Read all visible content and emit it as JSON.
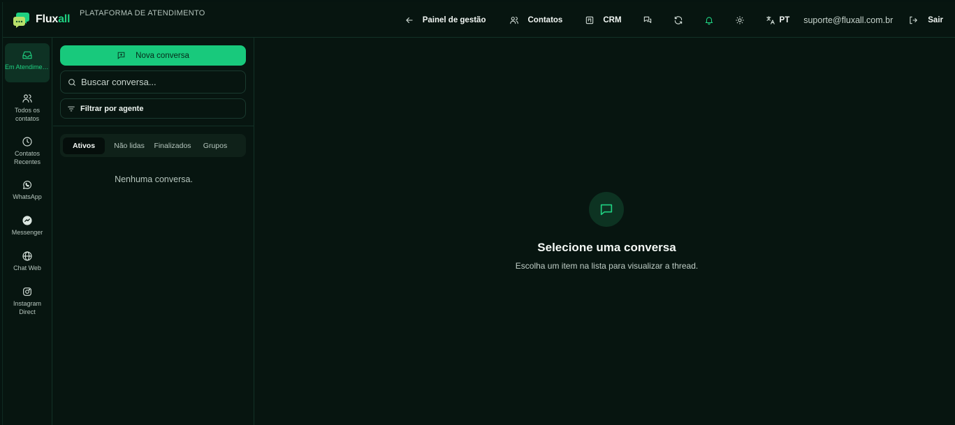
{
  "brand": {
    "name_main": "Flux",
    "name_accent": "all",
    "subtitle": "PLATAFORMA DE ATENDIMENTO",
    "accent_color": "#1fd081"
  },
  "header_nav": {
    "panel": {
      "label": "Painel de gestão",
      "icon": "arrow-left-icon"
    },
    "contacts": {
      "label": "Contatos",
      "icon": "users-icon"
    },
    "crm": {
      "label": "CRM",
      "icon": "kanban-icon"
    },
    "messages_icon": "messages-icon",
    "refresh_icon": "refresh-icon",
    "bell_icon": "bell-icon",
    "theme_icon": "sun-icon",
    "language": {
      "label": "PT",
      "icon": "translate-icon"
    },
    "user_email": "suporte@fluxall.com.br",
    "logout": {
      "label": "Sair",
      "icon": "logout-icon"
    }
  },
  "rail": {
    "items": [
      {
        "label": "Em Atendimento",
        "icon": "inbox-icon",
        "active": true
      },
      {
        "label": "Todos os contatos",
        "icon": "users-icon"
      },
      {
        "label": "Contatos Recentes",
        "icon": "clock-icon"
      },
      {
        "label": "WhatsApp",
        "icon": "whatsapp-icon"
      },
      {
        "label": "Messenger",
        "icon": "messenger-icon"
      },
      {
        "label": "Chat Web",
        "icon": "globe-icon"
      },
      {
        "label": "Instagram Direct",
        "icon": "instagram-icon"
      }
    ]
  },
  "list_panel": {
    "new_button": "Nova conversa",
    "search_placeholder": "Buscar conversa...",
    "filter_label": "Filtrar por agente",
    "tabs": [
      {
        "label": "Ativos",
        "active": true
      },
      {
        "label": "Não lidas"
      },
      {
        "label": "Finalizados"
      },
      {
        "label": "Grupos"
      }
    ],
    "empty_text": "Nenhuma conversa."
  },
  "thread": {
    "empty_title": "Selecione uma conversa",
    "empty_subtitle": "Escolha um item na lista para visualizar a thread."
  }
}
